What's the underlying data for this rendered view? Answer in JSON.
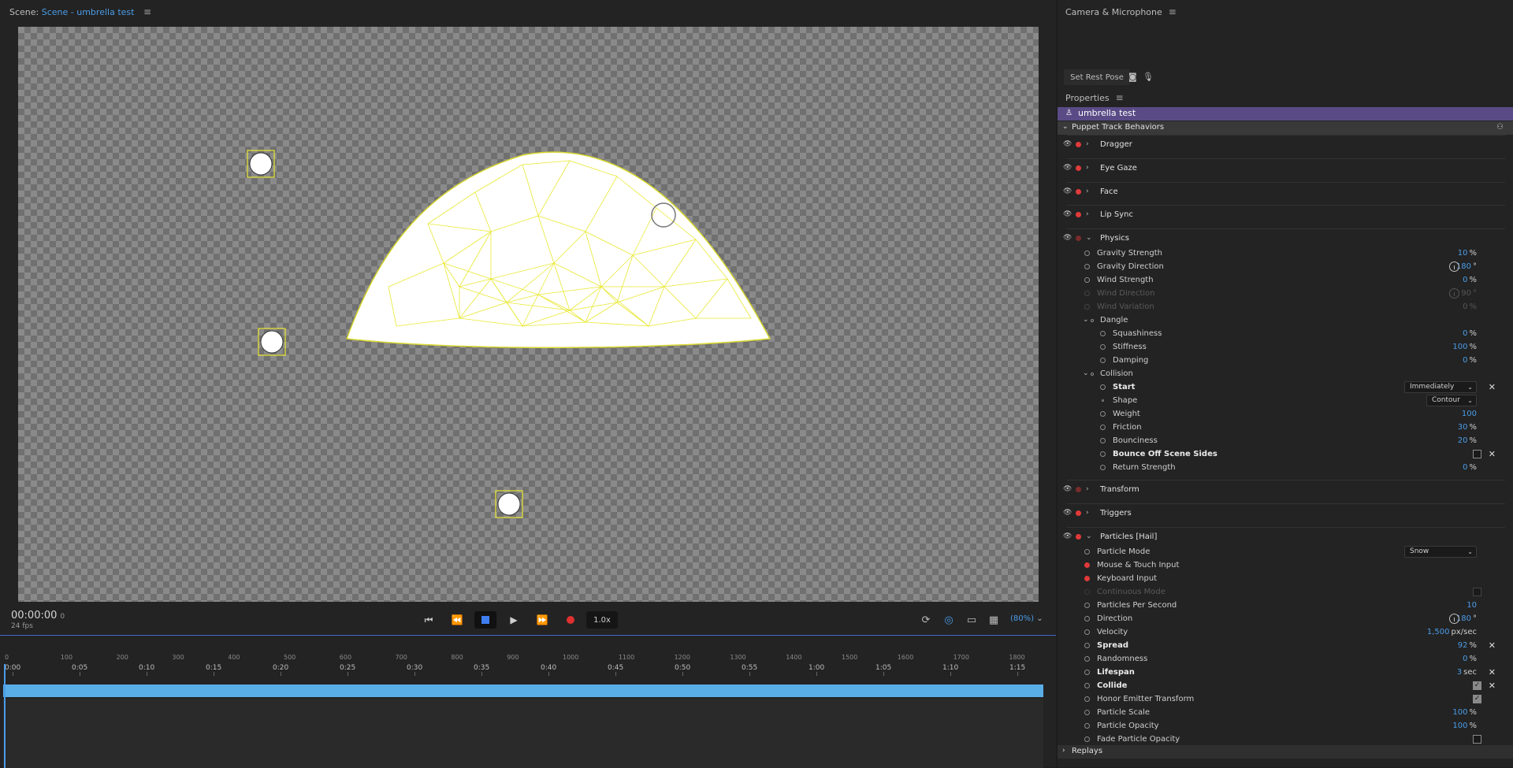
{
  "scene_panel": {
    "title_prefix": "Scene:",
    "scene_link": "Scene - umbrella test",
    "menu_icon": "hamburger-icon"
  },
  "transport": {
    "timecode": "00:00:00",
    "frame": "0",
    "fps": "24 fps",
    "speed": "1.0x",
    "zoom": "(80%)",
    "first_frame": "⏮",
    "step_back": "⏪",
    "play": "▶",
    "step_forward": "⏩",
    "loop_icon": "⟳",
    "camera_icon": "◎",
    "comment_icon": "▭",
    "grid_icon": "▦",
    "zoom_chevron": "⌄"
  },
  "timeline": {
    "frame_labels": [
      "0",
      "100",
      "200",
      "300",
      "400",
      "500",
      "600",
      "700",
      "800",
      "900",
      "1000",
      "1100",
      "1200",
      "1300",
      "1400",
      "1500",
      "1600",
      "1700",
      "1800"
    ],
    "time_labels": [
      "0:00",
      "0:05",
      "0:10",
      "0:15",
      "0:20",
      "0:25",
      "0:30",
      "0:35",
      "0:40",
      "0:45",
      "0:50",
      "0:55",
      "1:00",
      "1:05",
      "1:10",
      "1:15"
    ]
  },
  "camera_panel": {
    "title": "Camera & Microphone",
    "set_rest_pose": "Set Rest Pose"
  },
  "properties": {
    "title": "Properties",
    "puppet_name": "umbrella test",
    "section": "Puppet Track Behaviors",
    "behaviors": {
      "dragger": "Dragger",
      "eye_gaze": "Eye Gaze",
      "face": "Face",
      "lip_sync": "Lip Sync",
      "physics": "Physics",
      "transform": "Transform",
      "triggers": "Triggers",
      "particles": "Particles [Hail]"
    },
    "physics": {
      "gravity_strength": {
        "label": "Gravity Strength",
        "value": "10",
        "unit": "%"
      },
      "gravity_direction": {
        "label": "Gravity Direction",
        "value": "180",
        "unit": "°"
      },
      "wind_strength": {
        "label": "Wind Strength",
        "value": "0",
        "unit": "%"
      },
      "wind_direction": {
        "label": "Wind Direction",
        "value": "90",
        "unit": "°"
      },
      "wind_variation": {
        "label": "Wind Variation",
        "value": "0",
        "unit": "%"
      },
      "dangle": "Dangle",
      "squashiness": {
        "label": "Squashiness",
        "value": "0",
        "unit": "%"
      },
      "stiffness": {
        "label": "Stiffness",
        "value": "100",
        "unit": "%"
      },
      "damping": {
        "label": "Damping",
        "value": "0",
        "unit": "%"
      },
      "collision": "Collision",
      "start": {
        "label": "Start",
        "value": "Immediately"
      },
      "shape": {
        "label": "Shape",
        "value": "Contour"
      },
      "weight": {
        "label": "Weight",
        "value": "100"
      },
      "friction": {
        "label": "Friction",
        "value": "30",
        "unit": "%"
      },
      "bounciness": {
        "label": "Bounciness",
        "value": "20",
        "unit": "%"
      },
      "bounce_off_scene_sides": {
        "label": "Bounce Off Scene Sides"
      },
      "return_strength": {
        "label": "Return Strength",
        "value": "0",
        "unit": "%"
      }
    },
    "particles": {
      "particle_mode": {
        "label": "Particle Mode",
        "value": "Snow"
      },
      "mouse_touch_input": "Mouse & Touch Input",
      "keyboard_input": "Keyboard Input",
      "continuous_mode": "Continuous Mode",
      "particles_per_second": {
        "label": "Particles Per Second",
        "value": "10"
      },
      "direction": {
        "label": "Direction",
        "value": "180",
        "unit": "°"
      },
      "velocity": {
        "label": "Velocity",
        "value": "1,500",
        "unit": "px/sec"
      },
      "spread": {
        "label": "Spread",
        "value": "92",
        "unit": "%"
      },
      "randomness": {
        "label": "Randomness",
        "value": "0",
        "unit": "%"
      },
      "lifespan": {
        "label": "Lifespan",
        "value": "3",
        "unit": "sec"
      },
      "collide": {
        "label": "Collide"
      },
      "honor_emitter_transform": {
        "label": "Honor Emitter Transform"
      },
      "particle_scale": {
        "label": "Particle Scale",
        "value": "100",
        "unit": "%"
      },
      "particle_opacity": {
        "label": "Particle Opacity",
        "value": "100",
        "unit": "%"
      },
      "fade_particle_opacity": {
        "label": "Fade Particle Opacity"
      }
    },
    "replays": "Replays"
  },
  "colors": {
    "accent": "#4a9ce8",
    "puppet_row": "#5a4b86",
    "record": "#e03a3a",
    "mesh": "#e8e832",
    "track": "#5aaee8"
  }
}
